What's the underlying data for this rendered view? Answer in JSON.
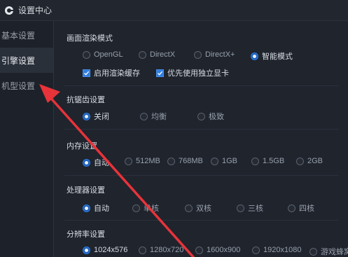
{
  "window": {
    "title": "设置中心"
  },
  "sidebar": {
    "items": [
      {
        "label": "基本设置",
        "active": false
      },
      {
        "label": "引擎设置",
        "active": true
      },
      {
        "label": "机型设置",
        "active": false
      }
    ]
  },
  "render": {
    "title": "画面渲染模式",
    "options": [
      "OpenGL",
      "DirectX",
      "DirectX+",
      "智能模式"
    ],
    "selected": "智能模式",
    "checkboxes": [
      {
        "label": "启用渲染缓存",
        "checked": true
      },
      {
        "label": "优先使用独立显卡",
        "checked": true
      }
    ]
  },
  "antialias": {
    "title": "抗锯齿设置",
    "options": [
      "关闭",
      "均衡",
      "极致"
    ],
    "selected": "关闭"
  },
  "memory": {
    "title": "内存设置",
    "options": [
      "自动",
      "512MB",
      "768MB",
      "1GB",
      "1.5GB",
      "2GB"
    ],
    "selected": "自动"
  },
  "cpu": {
    "title": "处理器设置",
    "options": [
      "自动",
      "单核",
      "双核",
      "三核",
      "四核"
    ],
    "selected": "自动"
  },
  "resolution": {
    "title": "分辨率设置",
    "options": [
      "1024x576",
      "1280x720",
      "1600x900",
      "1920x1080",
      "游戏蜂窝"
    ],
    "selected": "1024x576"
  },
  "colors": {
    "accent": "#2f7de1",
    "annotation_arrow": "#e8333a"
  },
  "icons": {
    "app": "app-logo-icon",
    "checkbox": "checkmark-icon"
  }
}
